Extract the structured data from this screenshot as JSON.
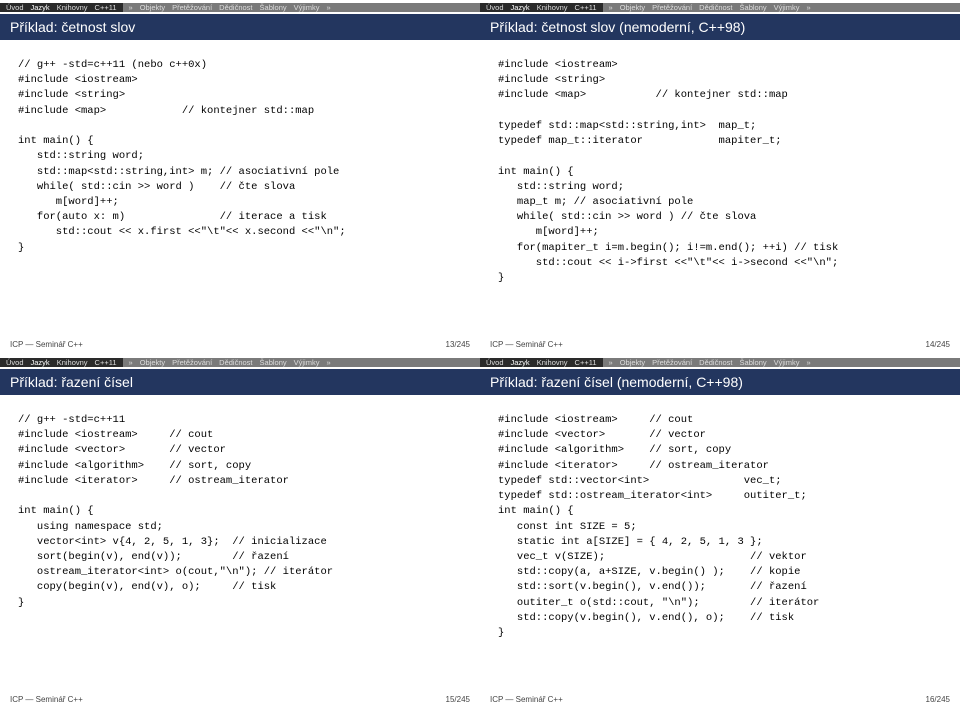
{
  "nav": {
    "dark": [
      "Úvod",
      "Jazyk",
      "Knihovny",
      "C++11"
    ],
    "light_arrow1": "»",
    "light": [
      "Objekty",
      "Přetěžování",
      "Dědičnost",
      "Šablony",
      "Výjimky"
    ],
    "light_arrow2": "»"
  },
  "slides": [
    {
      "title": "Příklad: četnost slov",
      "nav_hl": "Jazyk",
      "code": "// g++ -std=c++11 (nebo c++0x)\n#include <iostream>\n#include <string>\n#include <map>            // kontejner std::map\n\nint main() {\n   std::string word;\n   std::map<std::string,int> m; // asociativní pole\n   while( std::cin >> word )    // čte slova\n      m[word]++;\n   for(auto x: m)               // iterace a tisk\n      std::cout << x.first <<\"\\t\"<< x.second <<\"\\n\";\n}",
      "footer_left": "ICP — Seminář C++",
      "footer_right": "13/245"
    },
    {
      "title": "Příklad: četnost slov (nemoderní, C++98)",
      "nav_hl": "Jazyk",
      "code": "#include <iostream>\n#include <string>\n#include <map>           // kontejner std::map\n\ntypedef std::map<std::string,int>  map_t;\ntypedef map_t::iterator            mapiter_t;\n\nint main() {\n   std::string word;\n   map_t m; // asociativní pole\n   while( std::cin >> word ) // čte slova\n      m[word]++;\n   for(mapiter_t i=m.begin(); i!=m.end(); ++i) // tisk\n      std::cout << i->first <<\"\\t\"<< i->second <<\"\\n\";\n}",
      "footer_left": "ICP — Seminář C++",
      "footer_right": "14/245"
    },
    {
      "title": "Příklad: řazení čísel",
      "nav_hl": "Jazyk",
      "code": "// g++ -std=c++11\n#include <iostream>     // cout\n#include <vector>       // vector\n#include <algorithm>    // sort, copy\n#include <iterator>     // ostream_iterator\n\nint main() {\n   using namespace std;\n   vector<int> v{4, 2, 5, 1, 3};  // inicializace\n   sort(begin(v), end(v));        // řazení\n   ostream_iterator<int> o(cout,\"\\n\"); // iterátor\n   copy(begin(v), end(v), o);     // tisk\n}",
      "footer_left": "ICP — Seminář C++",
      "footer_right": "15/245"
    },
    {
      "title": "Příklad: řazení čísel (nemoderní, C++98)",
      "nav_hl": "Jazyk",
      "code": "#include <iostream>     // cout\n#include <vector>       // vector\n#include <algorithm>    // sort, copy\n#include <iterator>     // ostream_iterator\ntypedef std::vector<int>               vec_t;\ntypedef std::ostream_iterator<int>     outiter_t;\nint main() {\n   const int SIZE = 5;\n   static int a[SIZE] = { 4, 2, 5, 1, 3 };\n   vec_t v(SIZE);                       // vektor\n   std::copy(a, a+SIZE, v.begin() );    // kopie\n   std::sort(v.begin(), v.end());       // řazení\n   outiter_t o(std::cout, \"\\n\");        // iterátor\n   std::copy(v.begin(), v.end(), o);    // tisk\n}",
      "footer_left": "ICP — Seminář C++",
      "footer_right": "16/245"
    }
  ]
}
